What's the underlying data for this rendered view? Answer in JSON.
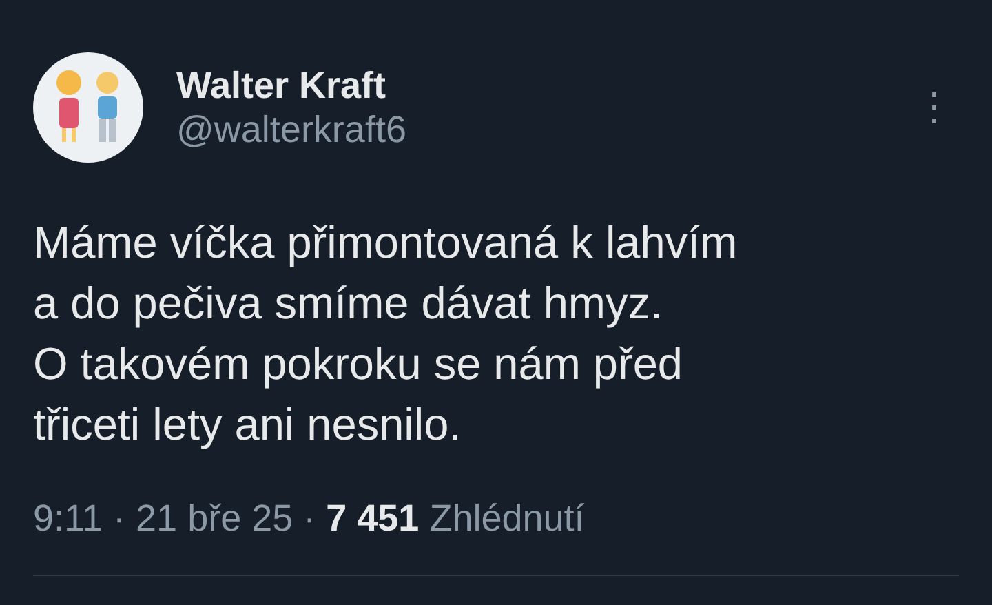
{
  "author": {
    "name": "Walter Kraft",
    "handle": "@walterkraft6"
  },
  "more_icon": "⋮",
  "text": "Máme víčka přimontovaná k lahvím\na do pečiva smíme dávat hmyz.\nO takovém pokroku se nám před\ntřiceti lety ani nesnilo.",
  "meta": "9:11 · 21 bře 25 · **7 451** Zhlédnutí"
}
